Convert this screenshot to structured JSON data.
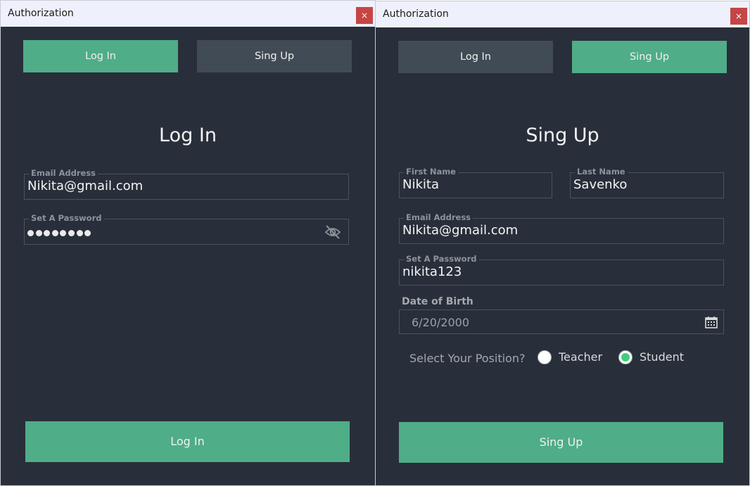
{
  "login_window": {
    "title": "Authorization",
    "close_glyph": "×",
    "tabs": {
      "login": "Log In",
      "signup": "Sing Up",
      "active": "login"
    },
    "heading": "Log In",
    "email": {
      "label": "Email Address",
      "value": "Nikita@gmail.com"
    },
    "password": {
      "label": "Set A Password",
      "masked_length": 8,
      "toggle_icon": "eye-off-icon"
    },
    "submit_label": "Log In"
  },
  "signup_window": {
    "title": "Authorization",
    "close_glyph": "×",
    "tabs": {
      "login": "Log In",
      "signup": "Sing Up",
      "active": "signup"
    },
    "heading": "Sing Up",
    "first_name": {
      "label": "First Name",
      "value": "Nikita"
    },
    "last_name": {
      "label": "Last Name",
      "value": "Savenko"
    },
    "email": {
      "label": "Email Address",
      "value": "Nikita@gmail.com"
    },
    "password": {
      "label": "Set A Password",
      "value": "nikita123"
    },
    "dob": {
      "label": "Date of Birth",
      "value": "6/20/2000",
      "icon": "calendar-icon"
    },
    "position": {
      "question": "Select Your Position?",
      "options": [
        "Teacher",
        "Student"
      ],
      "selected": "Student"
    },
    "submit_label": "Sing Up"
  },
  "colors": {
    "background": "#282f3a",
    "accent": "#4fad88",
    "tab_inactive": "#414b55",
    "close": "#c64545",
    "radio_selected": "#3fcf7a"
  }
}
